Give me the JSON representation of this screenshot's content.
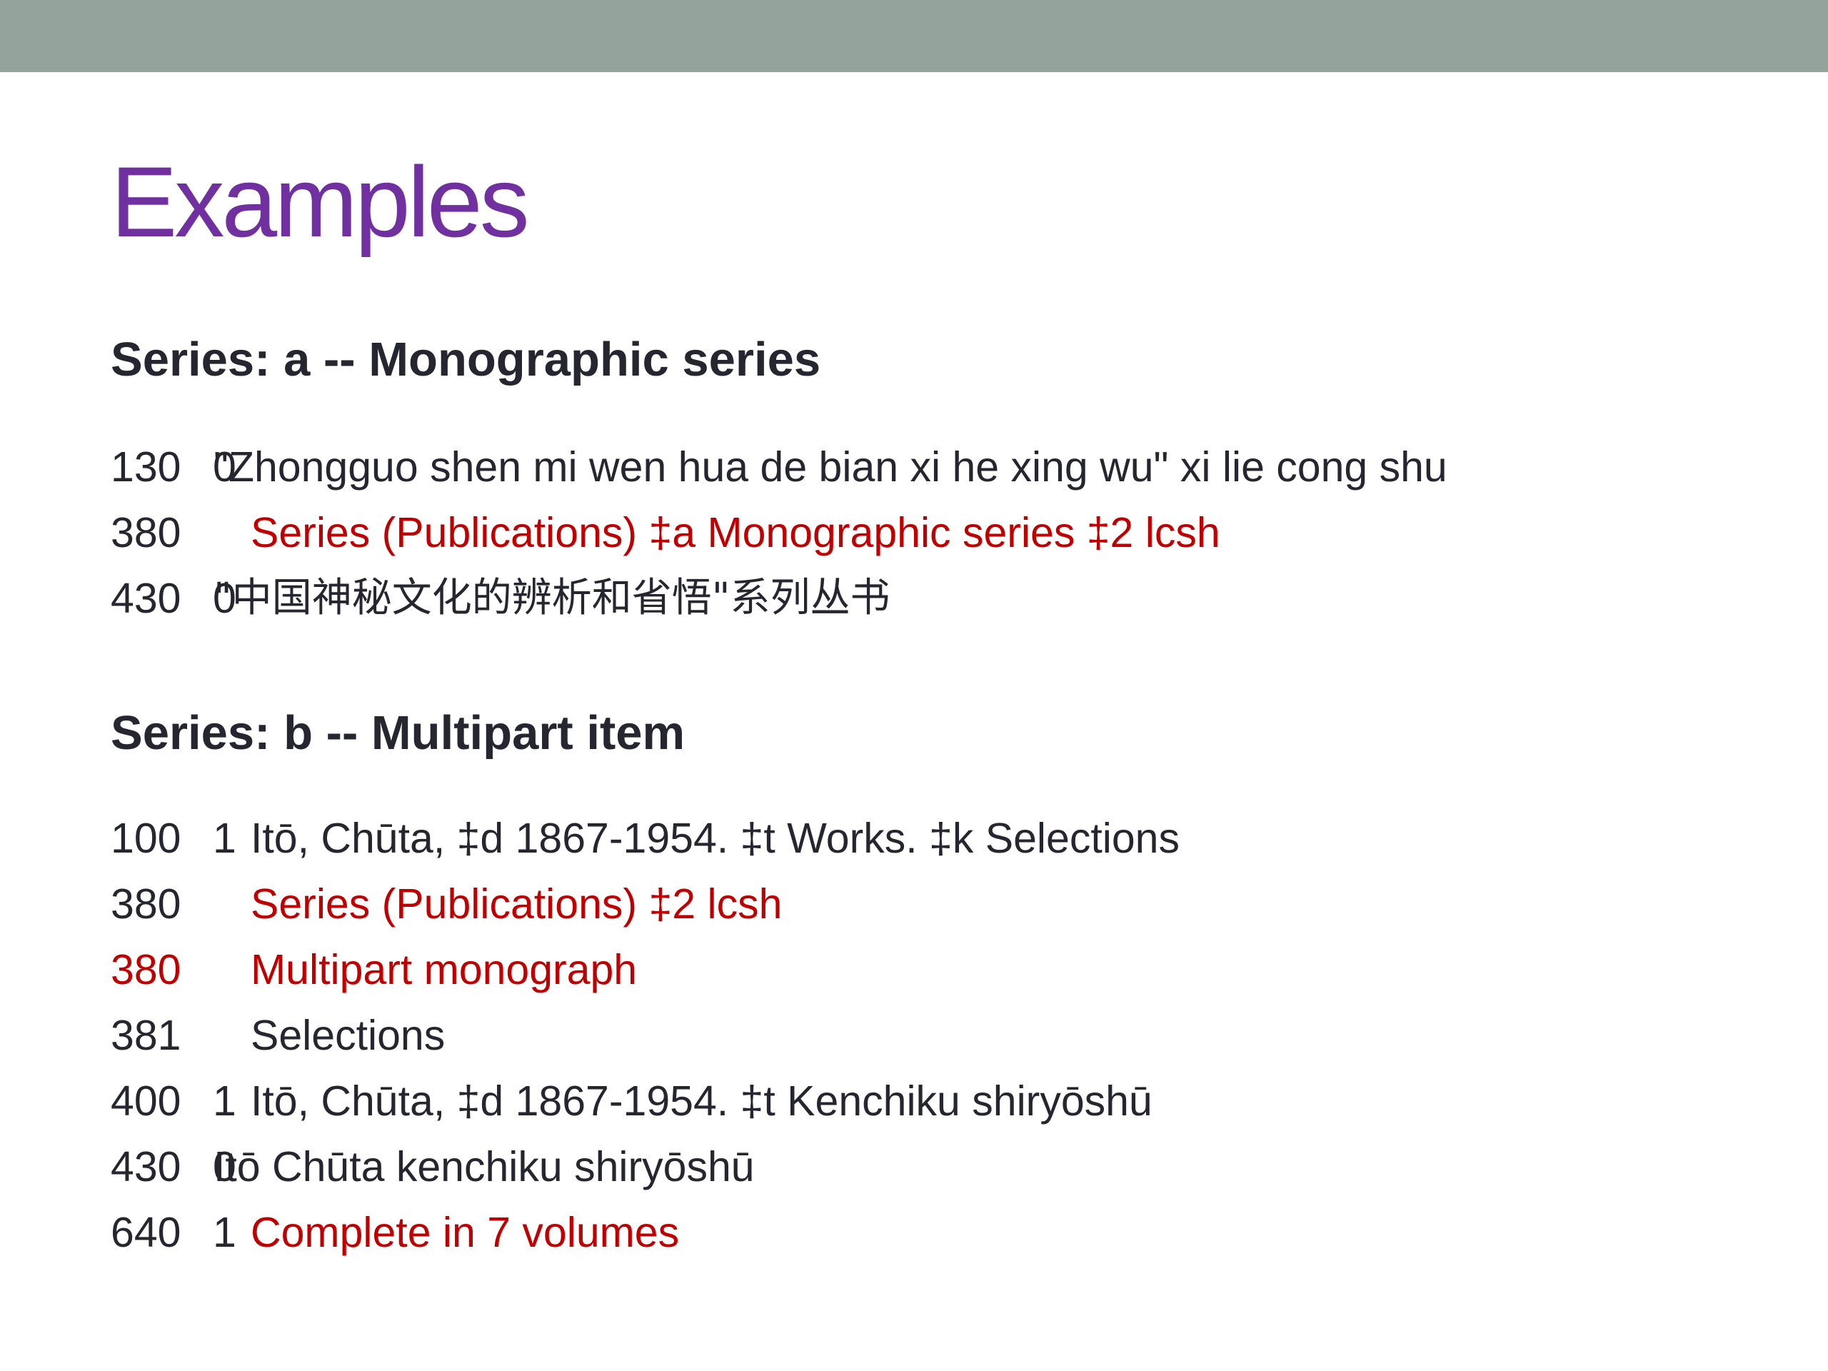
{
  "colors": {
    "top_bar": "#94a39b",
    "title": "#7030a0",
    "text": "#262630",
    "highlight": "#c00000"
  },
  "title": "Examples",
  "sections": [
    {
      "heading": "Series: a  -- Monographic series",
      "records": [
        {
          "tag": "130",
          "ind": "0",
          "content": "\"Zhongguo shen mi wen hua de bian xi he xing wu\" xi lie cong shu",
          "tag_highlight": false,
          "content_highlight": false
        },
        {
          "tag": "380",
          "ind": "",
          "content": "Series (Publications) ‡a Monographic series ‡2 lcsh",
          "tag_highlight": false,
          "content_highlight": true
        },
        {
          "tag": "430",
          "ind": "0",
          "content": "\"中国神秘文化的辨析和省悟\"系列丛书",
          "tag_highlight": false,
          "content_highlight": false
        }
      ]
    },
    {
      "heading": "Series: b  -- Multipart item",
      "records": [
        {
          "tag": "100",
          "ind": "1",
          "content": "Itō, Chūta, ‡d 1867-1954. ‡t Works. ‡k Selections",
          "tag_highlight": false,
          "content_highlight": false
        },
        {
          "tag": "380",
          "ind": "",
          "content": "Series (Publications) ‡2 lcsh",
          "tag_highlight": false,
          "content_highlight": true
        },
        {
          "tag": "380",
          "ind": "",
          "content": "Multipart monograph",
          "tag_highlight": true,
          "content_highlight": true
        },
        {
          "tag": "381",
          "ind": "",
          "content": "Selections",
          "tag_highlight": false,
          "content_highlight": false
        },
        {
          "tag": "400",
          "ind": "1",
          "content": "Itō, Chūta, ‡d 1867-1954. ‡t Kenchiku shiryōshū",
          "tag_highlight": false,
          "content_highlight": false
        },
        {
          "tag": "430",
          "ind": "0",
          "content": "Itō Chūta kenchiku shiryōshū",
          "tag_highlight": false,
          "content_highlight": false
        },
        {
          "tag": "640",
          "ind": "1",
          "content": "Complete in 7 volumes",
          "tag_highlight": false,
          "content_highlight": true
        }
      ]
    }
  ]
}
